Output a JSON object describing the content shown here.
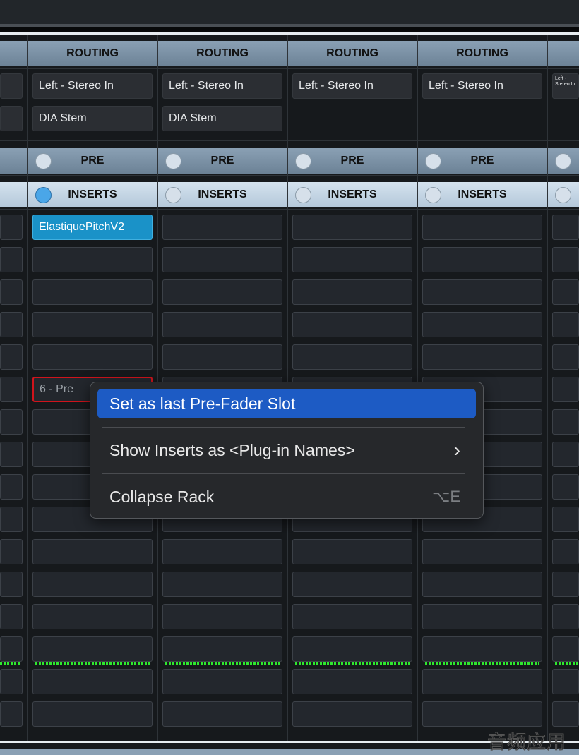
{
  "mixer": {
    "routing_label": "ROUTING",
    "pre_label": "PRE",
    "inserts_label": "INSERTS",
    "channels": [
      {
        "input": "",
        "output": "",
        "inserts_active": false,
        "inserts": []
      },
      {
        "input": "Left - Stereo In",
        "output": "DIA Stem",
        "inserts_active": true,
        "inserts": [
          "ElastiquePitchV2",
          "",
          "",
          "",
          "",
          "6 - Pre"
        ]
      },
      {
        "input": "Left - Stereo In",
        "output": "DIA Stem",
        "inserts_active": false,
        "inserts": []
      },
      {
        "input": "Left - Stereo In",
        "output": "",
        "inserts_active": false,
        "inserts": []
      },
      {
        "input": "Left - Stereo In",
        "output": "",
        "inserts_active": false,
        "inserts": []
      },
      {
        "input": "Left - Stereo In",
        "output": "",
        "inserts_active": false,
        "inserts": []
      }
    ],
    "selected_slot": "6 - Pre"
  },
  "context_menu": {
    "items": [
      {
        "label": "Set as last Pre-Fader Slot",
        "highlighted": true
      },
      {
        "label": "Show Inserts as <Plug-in Names>",
        "submenu": true,
        "submenu_icon": "chevron-right-icon",
        "glyph": "›"
      },
      {
        "label": "Collapse Rack",
        "shortcut": "⌥E"
      }
    ]
  },
  "watermark": "音频应用",
  "colors": {
    "highlight": "#1d5bc4",
    "plugin": "#1a92c8",
    "selected": "#d0141c",
    "meter": "#2ee82e"
  }
}
